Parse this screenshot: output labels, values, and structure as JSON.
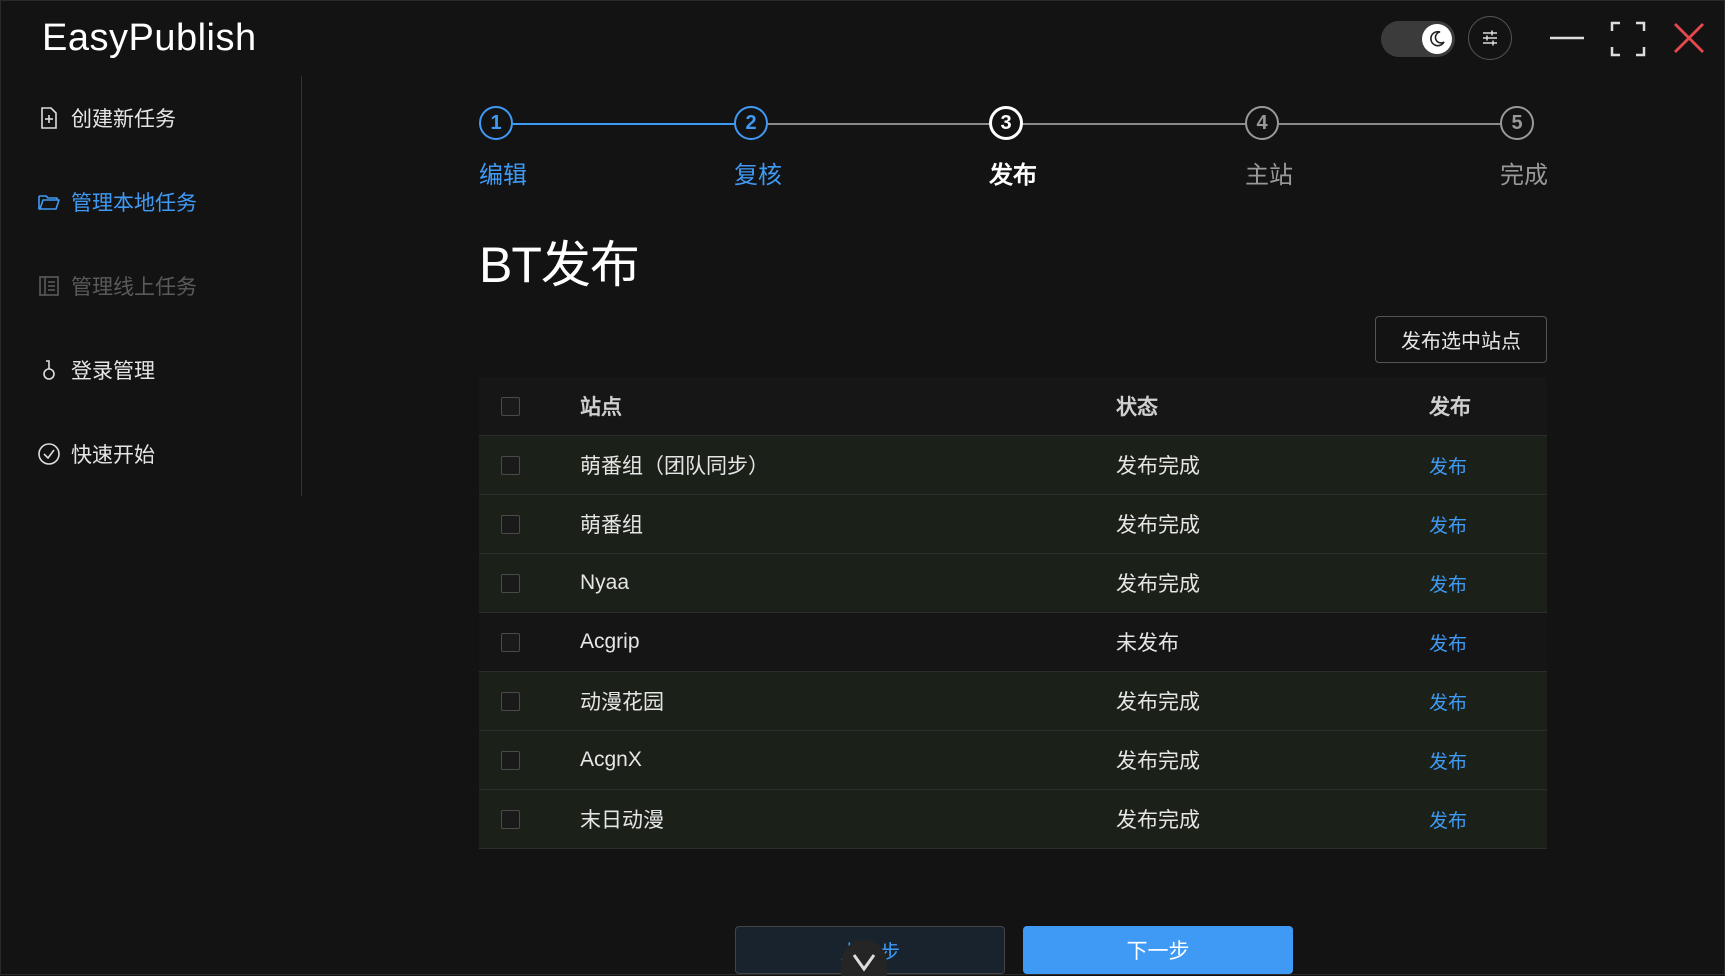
{
  "app": {
    "title": "EasyPublish"
  },
  "sidebar": {
    "items": [
      {
        "label": "创建新任务",
        "icon": "file-plus-icon",
        "state": "normal"
      },
      {
        "label": "管理本地任务",
        "icon": "folder-icon",
        "state": "active"
      },
      {
        "label": "管理线上任务",
        "icon": "list-doc-icon",
        "state": "disabled"
      },
      {
        "label": "登录管理",
        "icon": "key-icon",
        "state": "normal"
      },
      {
        "label": "快速开始",
        "icon": "check-circle-icon",
        "state": "normal"
      }
    ]
  },
  "steps": [
    {
      "number": "1",
      "label": "编辑",
      "status": "done"
    },
    {
      "number": "2",
      "label": "复核",
      "status": "done"
    },
    {
      "number": "3",
      "label": "发布",
      "status": "current"
    },
    {
      "number": "4",
      "label": "主站",
      "status": "pending"
    },
    {
      "number": "5",
      "label": "完成",
      "status": "pending"
    }
  ],
  "page": {
    "title": "BT发布"
  },
  "toolbar": {
    "publish_selected_label": "发布选中站点"
  },
  "table": {
    "headers": {
      "site": "站点",
      "status": "状态",
      "action": "发布"
    },
    "rows": [
      {
        "site": "萌番组（团队同步）",
        "status": "发布完成",
        "action": "发布"
      },
      {
        "site": "萌番组",
        "status": "发布完成",
        "action": "发布"
      },
      {
        "site": "Nyaa",
        "status": "发布完成",
        "action": "发布"
      },
      {
        "site": "Acgrip",
        "status": "未发布",
        "action": "发布"
      },
      {
        "site": "动漫花园",
        "status": "发布完成",
        "action": "发布"
      },
      {
        "site": "AcgnX",
        "status": "发布完成",
        "action": "发布"
      },
      {
        "site": "末日动漫",
        "status": "发布完成",
        "action": "发布"
      }
    ]
  },
  "footer": {
    "prev_label": "上一步",
    "next_label": "下一步"
  },
  "colors": {
    "accent": "#3f9af5",
    "background": "#131313",
    "close": "#e5484d",
    "row_done": "#1b2119"
  }
}
